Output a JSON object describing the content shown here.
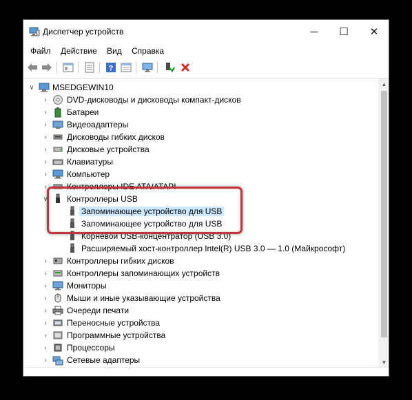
{
  "window": {
    "title": "Диспетчер устройств",
    "minimize_glyph": "─",
    "maximize_glyph": "☐",
    "close_glyph": "✕"
  },
  "menu": [
    "Файл",
    "Действие",
    "Вид",
    "Справка"
  ],
  "toolbar_icons": [
    "back-arrow-icon",
    "forward-arrow-icon",
    "properties-window-icon",
    "device-list-icon",
    "help-icon",
    "view-panel-icon",
    "monitor-scan-icon",
    "enable-device-icon",
    "uninstall-x-icon"
  ],
  "tree": {
    "root": "MSEDGEWIN10",
    "categories": [
      {
        "label": "DVD-дисководы и дисководы компакт-дисков",
        "icon": "dvd-drive-icon"
      },
      {
        "label": "Батареи",
        "icon": "battery-icon"
      },
      {
        "label": "Видеоадаптеры",
        "icon": "display-adapter-icon"
      },
      {
        "label": "Дисководы гибких дисков",
        "icon": "floppy-drive-icon"
      },
      {
        "label": "Дисковые устройства",
        "icon": "disk-drive-icon"
      },
      {
        "label": "Клавиатуры",
        "icon": "keyboard-icon"
      },
      {
        "label": "Компьютер",
        "icon": "computer-icon"
      },
      {
        "label": "Контроллеры IDE ATA/ATAPI",
        "icon": "ide-controller-icon"
      },
      {
        "label": "Контроллеры USB",
        "icon": "usb-controller-icon"
      }
    ],
    "usb_children": [
      "Запоминающее устройство для USB",
      "Запоминающее устройство для USB",
      "Корневой USB-концентратор (USB 3.0)",
      "Расширяемый хост-контроллер Intel(R) USB 3.0 — 1.0 (Майкрософт)"
    ],
    "categories_after": [
      {
        "label": "Контроллеры гибких дисков",
        "icon": "floppy-controller-icon"
      },
      {
        "label": "Контроллеры запоминающих устройств",
        "icon": "storage-controller-icon"
      },
      {
        "label": "Мониторы",
        "icon": "monitor-icon"
      },
      {
        "label": "Мыши и иные указывающие устройства",
        "icon": "mouse-icon"
      },
      {
        "label": "Очереди печати",
        "icon": "printer-icon"
      },
      {
        "label": "Переносные устройства",
        "icon": "portable-device-icon"
      },
      {
        "label": "Программные устройства",
        "icon": "software-device-icon"
      },
      {
        "label": "Процессоры",
        "icon": "processor-icon"
      },
      {
        "label": "Сетевые адаптеры",
        "icon": "network-adapter-icon"
      }
    ]
  },
  "highlight_color": "#c4343d",
  "selection_color": "#cce8ff"
}
